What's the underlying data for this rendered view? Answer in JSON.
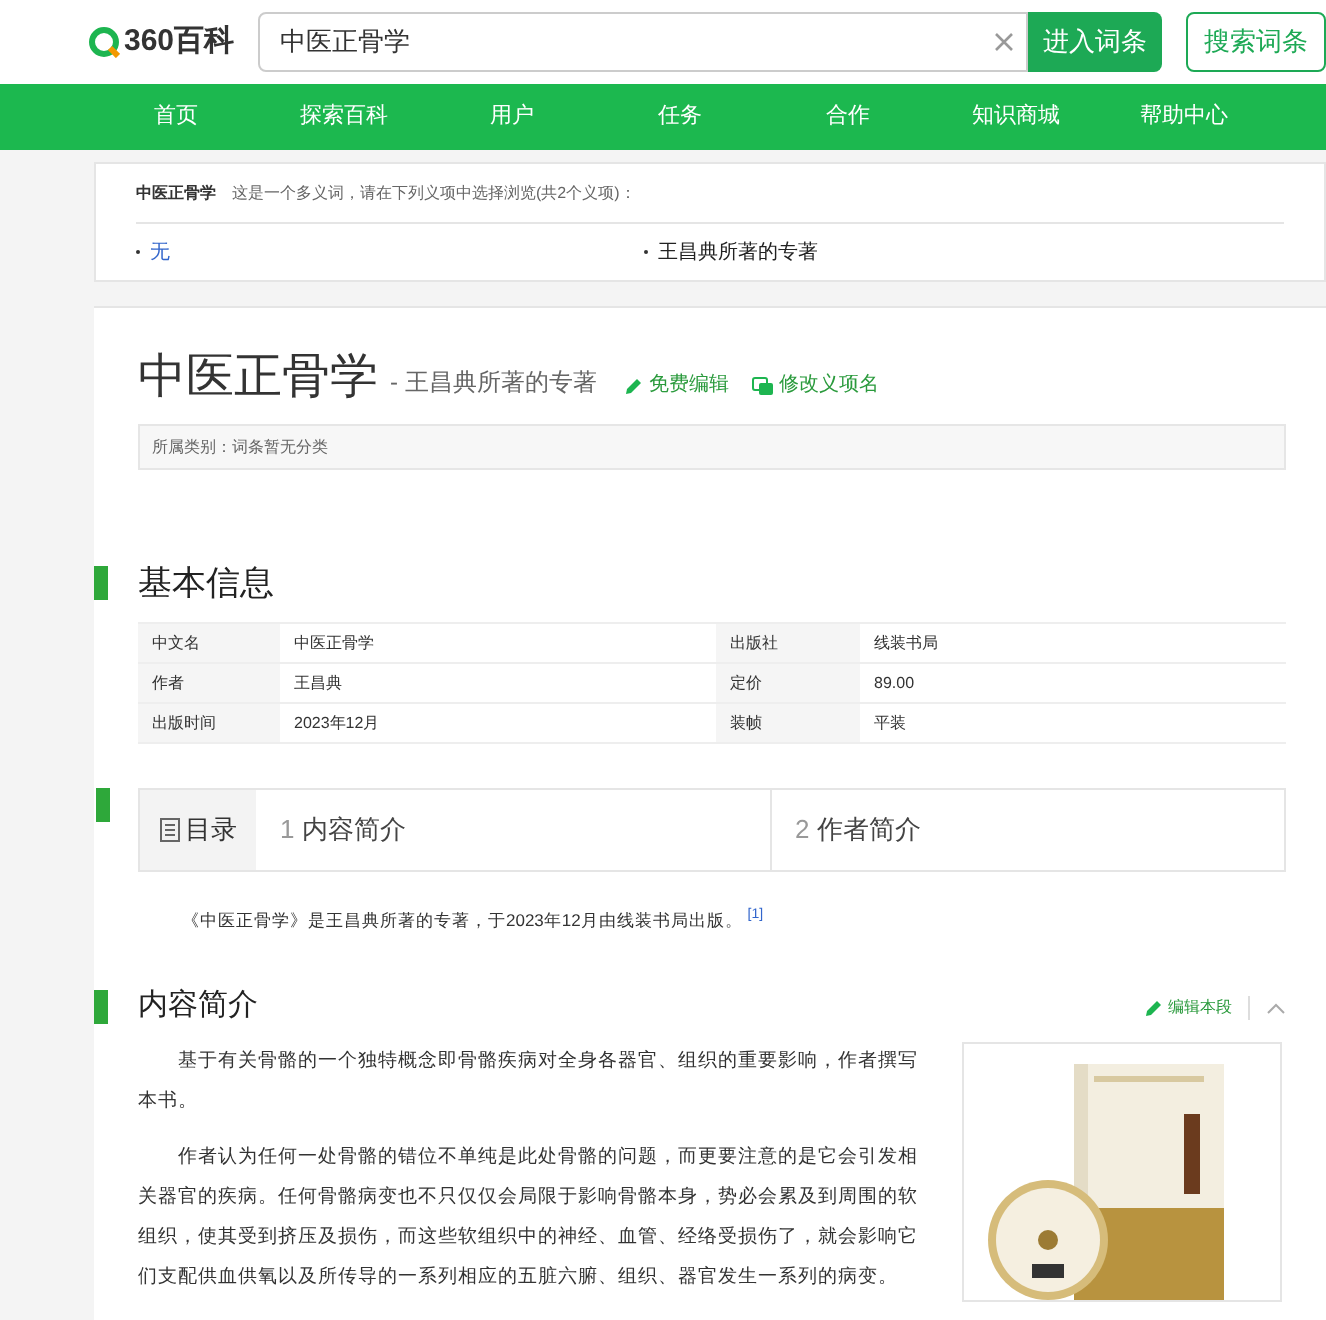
{
  "header": {
    "logo": "360百科",
    "search": {
      "value": "中医正骨学"
    },
    "enter_button": "进入词条",
    "search_button": "搜索词条"
  },
  "nav": [
    "首页",
    "探索百科",
    "用户",
    "任务",
    "合作",
    "知识商城",
    "帮助中心"
  ],
  "disambiguation": {
    "term": "中医正骨学",
    "note": "这是一个多义词，请在下列义项中选择浏览(共2个义项)：",
    "items": [
      {
        "label": "无",
        "selected": false
      },
      {
        "label": "王昌典所著的专著",
        "selected": true
      }
    ]
  },
  "entry": {
    "title": "中医正骨学",
    "subtitle": "- 王昌典所著的专著",
    "edit_link": "免费编辑",
    "rename_link": "修改义项名",
    "category": "所属类别：词条暂无分类"
  },
  "basic_info": {
    "heading": "基本信息",
    "rows": [
      {
        "label_1": "中文名",
        "value_1": "中医正骨学",
        "label_2": "出版社",
        "value_2": "线装书局"
      },
      {
        "label_1": "作者",
        "value_1": "王昌典",
        "label_2": "定价",
        "value_2": "89.00"
      },
      {
        "label_1": "出版时间",
        "value_1": "2023年12月",
        "label_2": "装帧",
        "value_2": "平装"
      }
    ]
  },
  "toc": {
    "label": "目录",
    "items": [
      {
        "number": "1",
        "title": "内容简介"
      },
      {
        "number": "2",
        "title": "作者简介"
      }
    ]
  },
  "summary": {
    "text": "《中医正骨学》是王昌典所著的专著，于2023年12月由线装书局出版。",
    "ref": "[1]"
  },
  "section": {
    "heading": "内容简介",
    "edit_link": "编辑本段",
    "paragraphs": [
      "基于有关骨骼的一个独特概念即骨骼疾病对全身各器官、组织的重要影响，作者撰写本书。",
      "作者认为任何一处骨骼的错位不单纯是此处骨骼的问题，而更要注意的是它会引发相关器官的疾病。任何骨骼病变也不只仅仅会局限于影响骨骼本身，势必会累及到周围的软组织，使其受到挤压及损伤，而这些软组织中的神经、血管、经络受损伤了，就会影响它们支配供血供氧以及所传导的一系列相应的五脏六腑、组织、器官发生一系列的病变。"
    ]
  }
}
